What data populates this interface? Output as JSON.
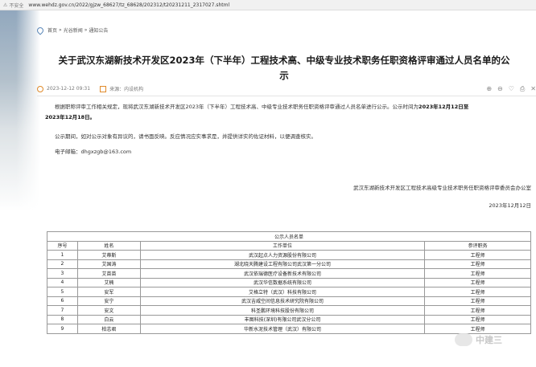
{
  "browser": {
    "security_label": "不安全",
    "url": "www.wehdz.gov.cn/2022/gjzw_68627/tz_68628/202312/t20231211_2317027.shtml"
  },
  "breadcrumb": [
    "首页",
    "光谷新闻",
    "通知公告"
  ],
  "breadcrumb_sep": "»",
  "article": {
    "title_line1": "关于武汉东湖新技术开发区2023年（下半年）工程技术高、中级专业技术职务任职资格评审通过人员名单的公",
    "title_line2": "示",
    "date": "2023-12-12 09:31",
    "source_label": "来源：",
    "source_value": "内设机构",
    "para1_lead": "根据职称评审工作相关规定，现将武汉东湖新技术开发区2023年（下半年）工程技术高、中级专业技术职务任职资格评审通过人员名单进行公示。公示时间为",
    "para1_bold1": "2023年12月12日至",
    "para1_bold2": "2023年12月18日。",
    "para2": "公示期间，如对公示对象有异议的，请书面反映。反应情况应实事求是，并提供详实的佐证材料，以便调查核实。",
    "email_label": "电子邮箱：",
    "email_value": "dhgxzgb@163.com",
    "signature": "武汉东湖新技术开发区工程技术高级专业技术职务任职资格评审委员会办公室",
    "sign_date": "2023年12月12日"
  },
  "table": {
    "caption": "公示人员名单",
    "headers": [
      "序号",
      "姓名",
      "工作单位",
      "参评职务"
    ],
    "rows": [
      [
        "1",
        "艾蒂斯",
        "武汉起点人力资源股份有限公司",
        "工程师"
      ],
      [
        "2",
        "艾国涛",
        "湖北晓天腾建设工程有限公司武汉第一分公司",
        "工程师"
      ],
      [
        "3",
        "艾苗苗",
        "武汉依瑞德医疗设备新技术有限公司",
        "工程师"
      ],
      [
        "4",
        "艾楠",
        "武汉华信数据系统有限公司",
        "工程师"
      ],
      [
        "5",
        "安军",
        "艾格立特（武汉）科技有限公司",
        "工程师"
      ],
      [
        "6",
        "安宁",
        "武汉吉威空间信息技术研究院有限公司",
        "工程师"
      ],
      [
        "7",
        "安文",
        "科圣鹏环境科技股份有限公司",
        "工程师"
      ],
      [
        "8",
        "白云",
        "丰图科技(深圳)有限公司武汉分公司",
        "工程师"
      ],
      [
        "9",
        "柏志君",
        "华新水泥技术管理（武汉）有限公司",
        "工程师"
      ]
    ]
  },
  "watermark": "中建三"
}
